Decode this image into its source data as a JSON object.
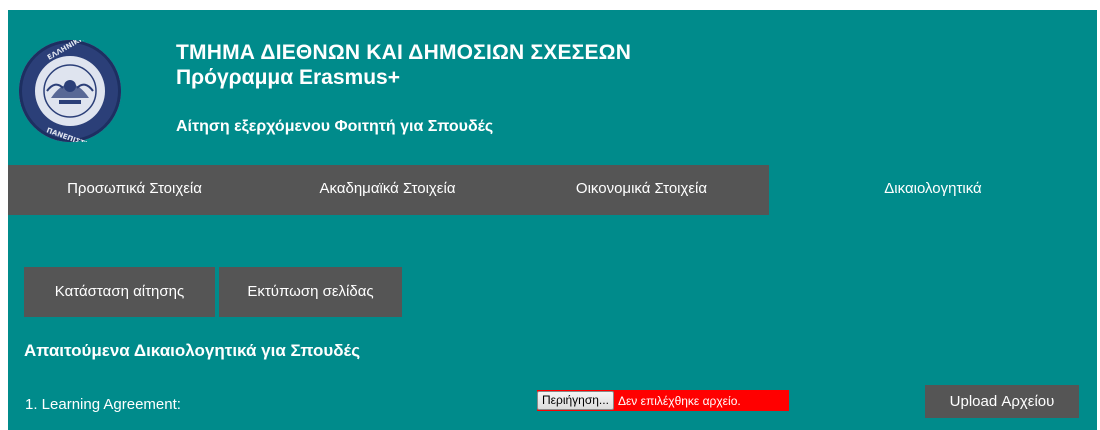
{
  "header": {
    "title": "ΤΜΗΜΑ ΔΙΕΘΝΩΝ ΚΑΙ ΔΗΜΟΣΙΩΝ ΣΧΕΣΕΩΝ",
    "program": "Πρόγραμμα Erasmus+",
    "form_title": "Αίτηση εξερχόμενου Φοιτητή για Σπουδές",
    "logo_icon": "university-seal-logo"
  },
  "nav": {
    "items": [
      {
        "label": "Προσωπικά Στοιχεία",
        "active": false
      },
      {
        "label": "Ακαδημαϊκά Στοιχεία",
        "active": false
      },
      {
        "label": "Οικονομικά Στοιχεία",
        "active": false
      },
      {
        "label": "Δικαιολογητικά",
        "active": true
      }
    ]
  },
  "actions": {
    "status_label": "Κατάσταση αίτησης",
    "print_label": "Εκτύπωση σελίδας"
  },
  "documents": {
    "section_title": "Απαιτούμενα Δικαιολογητικά για Σπουδές",
    "items": [
      {
        "label": "1. Learning Agreement:",
        "browse_label": "Περιήγηση...",
        "file_status": "Δεν επιλέχθηκε αρχείο.",
        "upload_label": "Upload Αρχείου"
      }
    ]
  },
  "colors": {
    "background": "#008b8b",
    "nav_bg": "#555555",
    "file_input_bg": "#ff0000",
    "text": "#ffffff"
  }
}
